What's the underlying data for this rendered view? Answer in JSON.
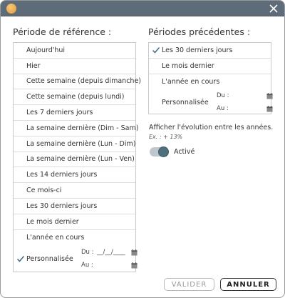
{
  "window": {
    "app_icon": "orange-circle-icon",
    "close_icon": "close-icon"
  },
  "reference": {
    "title": "Période de référence :",
    "items": [
      "Aujourd'hui",
      "Hier",
      "Cette semaine (depuis dimanche)",
      "Cette semaine (depuis lundi)",
      "Les 7 derniers jours",
      "La semaine dernière (Dim - Sam)",
      "La semaine dernière (Lun - Dim)",
      "La semaine dernière (Lun - Ven)",
      "Les 14 derniers jours",
      "Ce mois-ci",
      "Les 30 derniers jours",
      "Le mois dernier",
      "L'année en cours"
    ],
    "custom_label": "Personnalisée",
    "custom_selected": true,
    "du_label": "Du :",
    "du_value": "__/__/____",
    "au_label": "Au :",
    "au_value": ""
  },
  "previous": {
    "title": "Périodes précédentes :",
    "items": [
      "Les 30 derniers jours",
      "Le mois dernier",
      "L'année en cours"
    ],
    "selected_index": 0,
    "custom_label": "Personnalisée",
    "du_label": "Du :",
    "au_label": "Au :"
  },
  "evolution": {
    "title": "Afficher l'évolution entre les années.",
    "example": "Ex. : + 13%",
    "toggle_label": "Activé",
    "toggle_on": true
  },
  "buttons": {
    "validate": "VALIDER",
    "cancel": "ANNULER"
  },
  "colors": {
    "titlebar": "#5e6b78",
    "accent": "#3d6b8a",
    "toggle_knob": "#4f6f7c"
  }
}
